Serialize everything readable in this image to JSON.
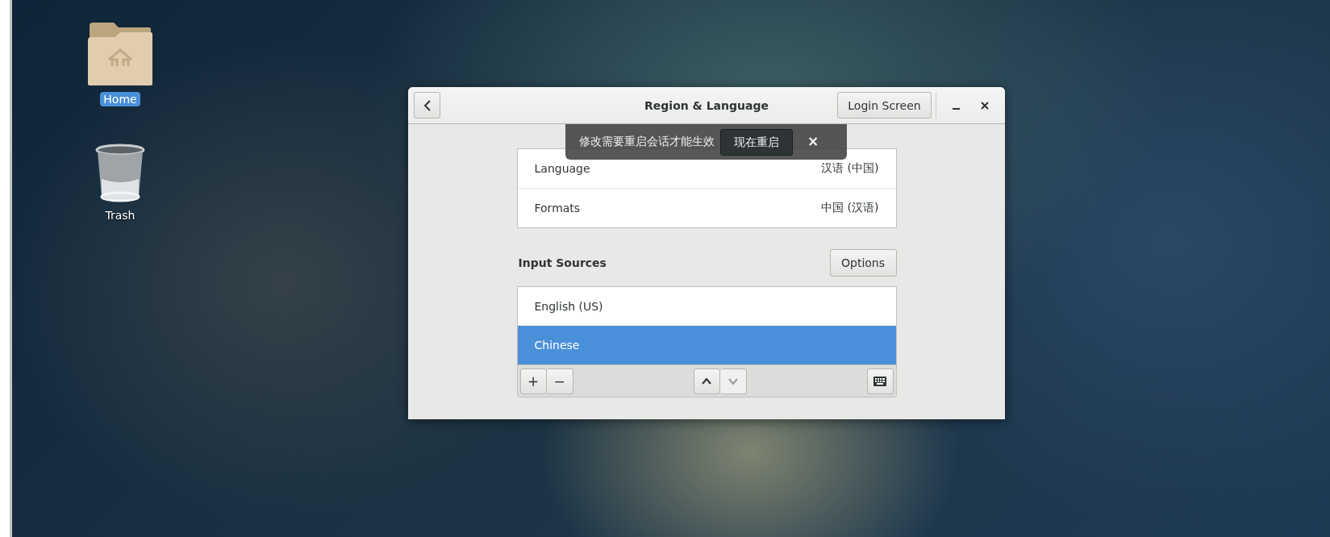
{
  "desktop_icons": [
    {
      "kind": "home",
      "label": "Home",
      "selected": true
    },
    {
      "kind": "trash",
      "label": "Trash",
      "selected": false
    }
  ],
  "window": {
    "title": "Region & Language",
    "login_button": "Login Screen"
  },
  "notification": {
    "message": "修改需要重启会话才能生效",
    "action": "现在重启",
    "close": "×"
  },
  "settings": [
    {
      "label": "Language",
      "value": "汉语 (中国)"
    },
    {
      "label": "Formats",
      "value": "中国 (汉语)"
    }
  ],
  "input_sources": {
    "title": "Input Sources",
    "options_button": "Options",
    "items": [
      {
        "label": "English (US)",
        "selected": false
      },
      {
        "label": "Chinese",
        "selected": true
      }
    ],
    "add": "+",
    "remove": "−",
    "move_buttons": [
      {
        "kind": "up",
        "disabled": false
      },
      {
        "kind": "down",
        "disabled": true
      }
    ]
  }
}
